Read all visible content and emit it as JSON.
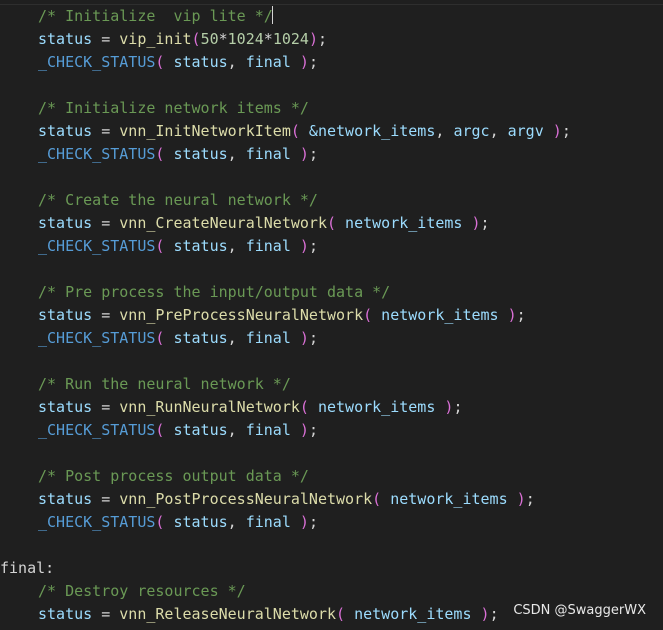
{
  "watermark": "CSDN @SwaggerWX",
  "code": {
    "l0": {
      "comment": "/* Initialize  vip lite */"
    },
    "l1": {
      "var": "status",
      "eq": " = ",
      "func": "vip_init",
      "open": "(",
      "args": "50",
      "op1": "*",
      "n2": "1024",
      "op2": "*",
      "n3": "1024",
      "close": ")",
      "end": ";"
    },
    "l2": {
      "macro": "_CHECK_STATUS",
      "open": "(",
      "a1": "status",
      "sep": ", ",
      "a2": "final",
      "close": " )",
      "end": ";"
    },
    "l3": {},
    "l4": {
      "comment": "/* Initialize network items */"
    },
    "l5": {
      "var": "status",
      "eq": " = ",
      "func": "vnn_InitNetworkItem",
      "open": "(",
      "a1": " &network_items",
      "sep1": ", ",
      "a2": "argc",
      "sep2": ", ",
      "a3": "argv",
      "close": " )",
      "end": ";"
    },
    "l6": {
      "macro": "_CHECK_STATUS",
      "open": "(",
      "a1": "status",
      "sep": ", ",
      "a2": "final",
      "close": " )",
      "end": ";"
    },
    "l7": {},
    "l8": {
      "comment": "/* Create the neural network */"
    },
    "l9": {
      "var": "status",
      "eq": " = ",
      "func": "vnn_CreateNeuralNetwork",
      "open": "(",
      "a1": " network_items",
      "close": " )",
      "end": ";"
    },
    "l10": {
      "macro": "_CHECK_STATUS",
      "open": "(",
      "a1": "status",
      "sep": ", ",
      "a2": "final",
      "close": " )",
      "end": ";"
    },
    "l11": {},
    "l12": {
      "comment": "/* Pre process the input/output data */"
    },
    "l13": {
      "var": "status",
      "eq": " = ",
      "func": "vnn_PreProcessNeuralNetwork",
      "open": "(",
      "a1": " network_items",
      "close": " )",
      "end": ";"
    },
    "l14": {
      "macro": "_CHECK_STATUS",
      "open": "(",
      "a1": "status",
      "sep": ", ",
      "a2": "final",
      "close": " )",
      "end": ";"
    },
    "l15": {},
    "l16": {
      "comment": "/* Run the neural network */"
    },
    "l17": {
      "var": "status",
      "eq": " = ",
      "func": "vnn_RunNeuralNetwork",
      "open": "(",
      "a1": " network_items",
      "close": " )",
      "end": ";"
    },
    "l18": {
      "macro": "_CHECK_STATUS",
      "open": "(",
      "a1": "status",
      "sep": ", ",
      "a2": "final",
      "close": " )",
      "end": ";"
    },
    "l19": {},
    "l20": {
      "comment": "/* Post process output data */"
    },
    "l21": {
      "var": "status",
      "eq": " = ",
      "func": "vnn_PostProcessNeuralNetwork",
      "open": "(",
      "a1": " network_items",
      "close": " )",
      "end": ";"
    },
    "l22": {
      "macro": "_CHECK_STATUS",
      "open": "(",
      "a1": "status",
      "sep": ", ",
      "a2": "final",
      "close": " )",
      "end": ";"
    },
    "l23": {},
    "l24": {
      "label": "final:"
    },
    "l25": {
      "comment": "/* Destroy resources */"
    },
    "l26": {
      "var": "status",
      "eq": " = ",
      "func": "vnn_ReleaseNeuralNetwork",
      "open": "(",
      "a1": " network_items",
      "close": " )",
      "end": ";"
    }
  },
  "colors": {
    "background": "#1f1f1f",
    "comment": "#6a9955",
    "variable": "#9cdcfe",
    "function": "#dcdcaa",
    "bracket": "#da70d6",
    "number": "#b5cea8",
    "macro": "#569cd6"
  }
}
